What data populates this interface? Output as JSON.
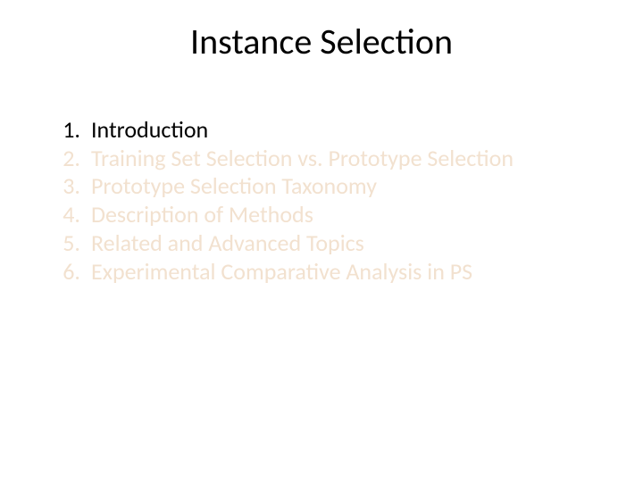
{
  "title": "Instance Selection",
  "items": [
    {
      "n": "1.",
      "label": "Introduction",
      "highlighted": true
    },
    {
      "n": "2.",
      "label": "Training Set Selection vs. Prototype Selection",
      "highlighted": false
    },
    {
      "n": "3.",
      "label": "Prototype Selection Taxonomy",
      "highlighted": false
    },
    {
      "n": "4.",
      "label": "Description of Methods",
      "highlighted": false
    },
    {
      "n": "5.",
      "label": "Related and Advanced Topics",
      "highlighted": false
    },
    {
      "n": "6.",
      "label": "Experimental Comparative Analysis in PS",
      "highlighted": false
    }
  ],
  "colors": {
    "highlight": "#000000",
    "dim": "#f2e1cf"
  }
}
